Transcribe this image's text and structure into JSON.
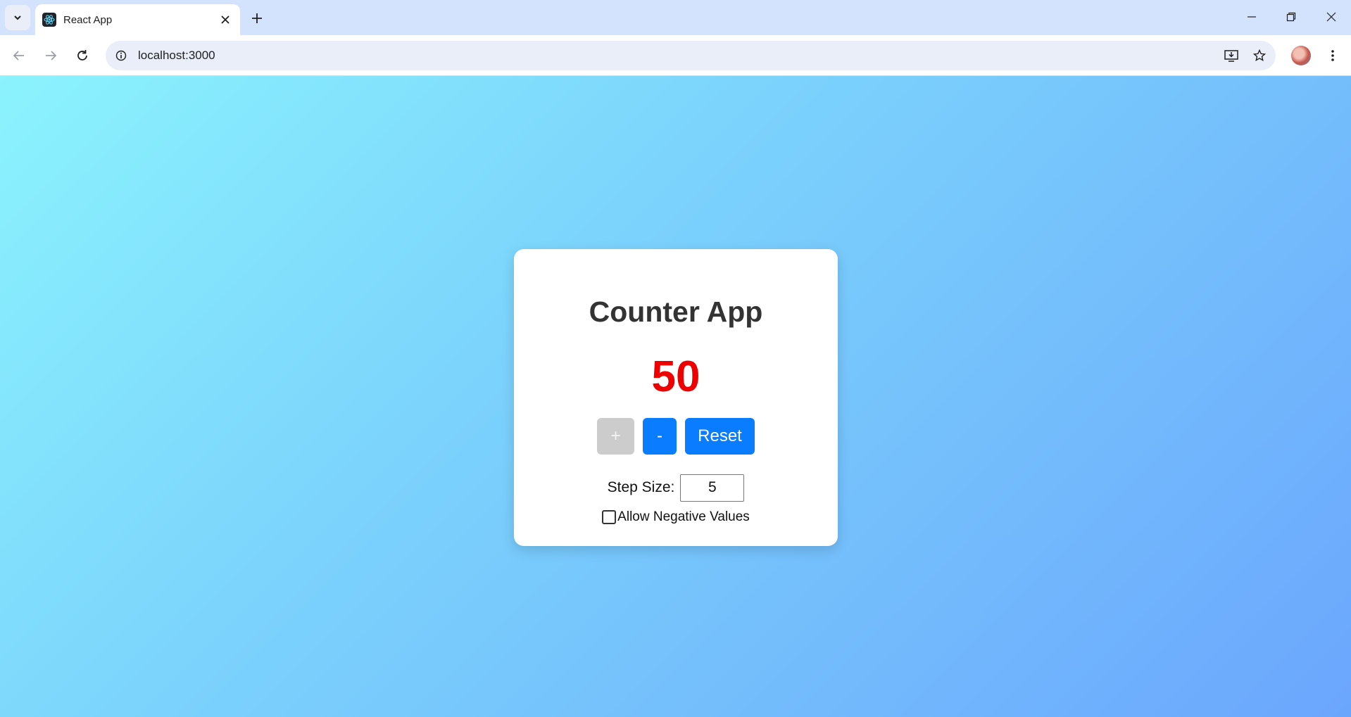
{
  "browser": {
    "tab_title": "React App",
    "url": "localhost:3000"
  },
  "app": {
    "title": "Counter App",
    "counter_value": "50",
    "counter_color": "#ee0000",
    "buttons": {
      "increment_label": "+",
      "decrement_label": "-",
      "reset_label": "Reset"
    },
    "step_size_label": "Step Size:",
    "step_size_value": "5",
    "allow_negative_label": "Allow Negative Values",
    "allow_negative_checked": false
  },
  "colors": {
    "accent": "#0a7cff",
    "disabled": "#cccccc",
    "gradient_start": "#8bf3fd",
    "gradient_end": "#6ba6fd"
  }
}
